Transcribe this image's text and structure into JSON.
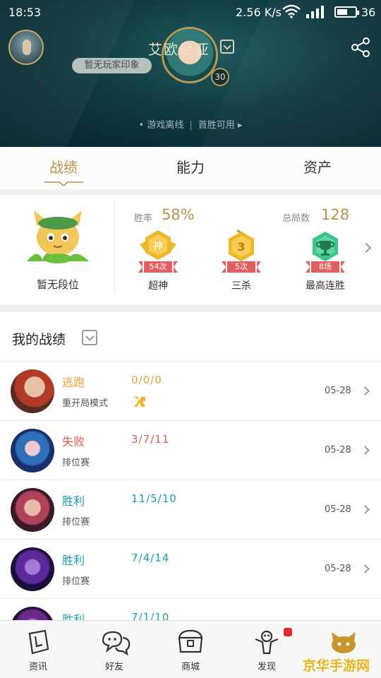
{
  "status_bar": {
    "time": "18:53",
    "network_speed": "2.56 K/s",
    "battery": "36"
  },
  "profile": {
    "player_name": "艾欧尼亚",
    "impression": "暂无玩家印象",
    "level": "30",
    "online_status": "游戏离线",
    "first_win": "首胜可用"
  },
  "tabs": [
    {
      "label": "战绩",
      "active": true
    },
    {
      "label": "能力",
      "active": false
    },
    {
      "label": "资产",
      "active": false
    }
  ],
  "stats": {
    "rank": "暂无段位",
    "win_rate_label": "胜率",
    "win_rate": "58%",
    "total_games_label": "总局数",
    "total_games": "128",
    "badges": [
      {
        "glyph": "神",
        "count": "54次",
        "name": "超神",
        "color": "#f0b72a"
      },
      {
        "glyph": "3",
        "count": "5次",
        "name": "三杀",
        "color": "#f0b72a"
      },
      {
        "glyph": "trophy",
        "count": "8场",
        "name": "最高连胜",
        "color": "#3cc58a"
      }
    ]
  },
  "records": {
    "title": "我的战绩",
    "items": [
      {
        "result": "逃跑",
        "kda": "0/0/0",
        "mode": "重开局模式",
        "date": "05-28",
        "color": "#e8a23a"
      },
      {
        "result": "失败",
        "kda": "3/7/11",
        "mode": "排位赛",
        "date": "05-28",
        "color": "#e25a5a"
      },
      {
        "result": "胜利",
        "kda": "11/5/10",
        "mode": "排位赛",
        "date": "05-28",
        "color": "#1aa0b0"
      },
      {
        "result": "胜利",
        "kda": "7/4/14",
        "mode": "排位赛",
        "date": "05-28",
        "color": "#1aa0b0"
      },
      {
        "result": "胜利",
        "kda": "7/1/10",
        "mode": "",
        "date": "",
        "color": "#1aa0b0"
      }
    ]
  },
  "bottom_nav": [
    {
      "label": "资讯",
      "icon": "news-icon"
    },
    {
      "label": "好友",
      "icon": "friends-icon"
    },
    {
      "label": "商城",
      "icon": "store-icon"
    },
    {
      "label": "发现",
      "icon": "discover-icon"
    },
    {
      "label": "",
      "icon": "me-icon"
    }
  ],
  "watermark": "京华手游网"
}
